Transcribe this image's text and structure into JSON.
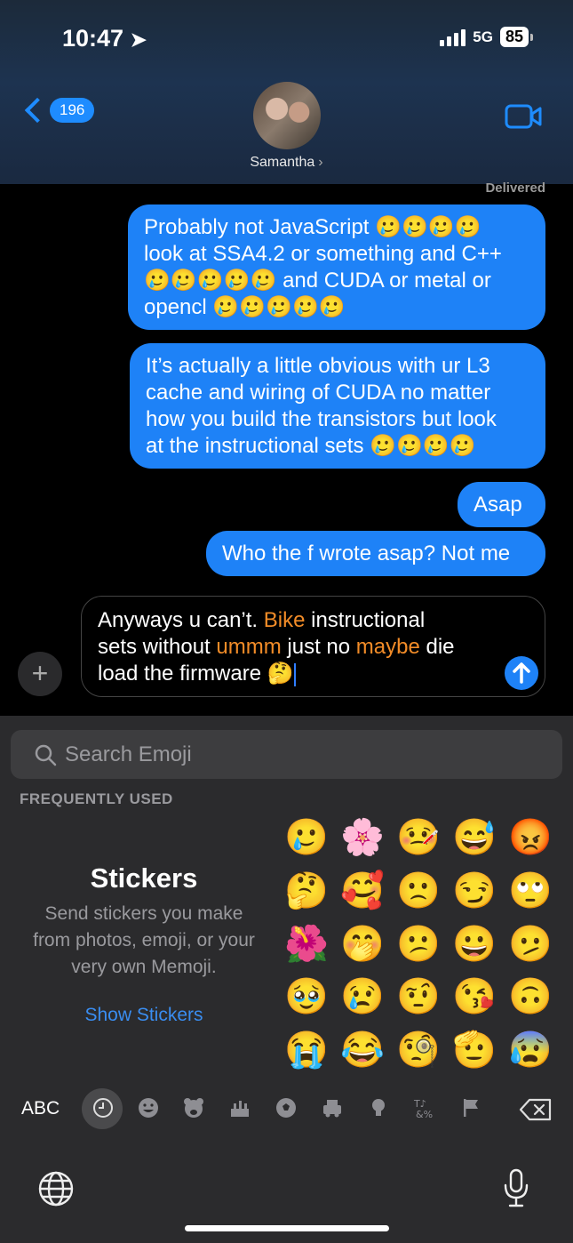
{
  "status_bar": {
    "time": "10:47",
    "network": "5G",
    "battery": "85"
  },
  "header": {
    "back_count": "196",
    "contact_name": "Samantha",
    "contact_chevron": "›"
  },
  "messages": {
    "delivered_label": "Delivered",
    "bubbles": [
      {
        "lines": [
          "Probably not JavaScript 🥲🥲🥲🥲",
          "look at SSA4.2 or something and C++",
          "🥲🥲🥲🥲🥲 and CUDA or metal or",
          "opencl 🥲🥲🥲🥲🥲"
        ]
      },
      {
        "lines": [
          "It’s actually a little obvious with ur L3",
          "cache and wiring of CUDA no matter",
          "how you build the transistors but look",
          "at the instructional sets 🥲🥲🥲🥲"
        ]
      },
      {
        "lines": [
          "Asap"
        ]
      },
      {
        "lines": [
          "Who the f wrote asap? Not me"
        ]
      }
    ]
  },
  "compose": {
    "segments": [
      {
        "text": "Anyways u can’t. ",
        "spell": false
      },
      {
        "text": "Bike",
        "spell": true
      },
      {
        "text": " instructional",
        "spell": false
      },
      {
        "text": "sets without ",
        "spell": false
      },
      {
        "text": "ummm",
        "spell": true
      },
      {
        "text": " just no ",
        "spell": false
      },
      {
        "text": "maybe",
        "spell": true
      },
      {
        "text": " die",
        "spell": false
      },
      {
        "text": "load the firmware 🤔",
        "spell": false
      }
    ],
    "plus_label": "+"
  },
  "keyboard": {
    "search_placeholder": "Search Emoji",
    "section_title": "FREQUENTLY USED",
    "stickers": {
      "title": "Stickers",
      "description": "Send stickers you make from photos, emoji, or your very own Memoji.",
      "button": "Show Stickers"
    },
    "emoji_grid": [
      [
        "🥲",
        "🌸",
        "🤒",
        "😅",
        "😡"
      ],
      [
        "🤔",
        "🥰",
        "🙁",
        "😏",
        "🙄"
      ],
      [
        "🌺",
        "🤭",
        "😕",
        "😀",
        "🫤"
      ],
      [
        "🥹",
        "😢",
        "🤨",
        "😘",
        "🙃"
      ],
      [
        "😭",
        "😂",
        "🧐",
        "🫡",
        "😰"
      ]
    ],
    "abc_label": "ABC",
    "categories": [
      "recent-icon",
      "smiley-icon",
      "bear-icon",
      "food-icon",
      "ball-icon",
      "car-icon",
      "bulb-icon",
      "symbols-icon",
      "flag-icon"
    ]
  }
}
